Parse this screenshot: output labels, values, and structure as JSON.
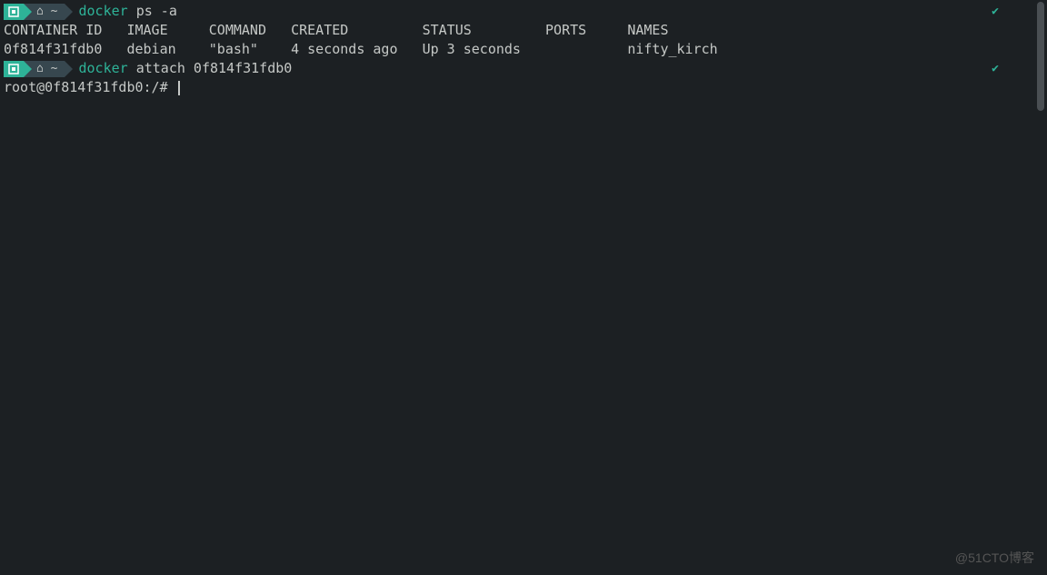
{
  "prompt1": {
    "badge_symbol": "⎕",
    "home_icon": "⌂",
    "tilde": "~",
    "command_docker": "docker",
    "command_args": " ps -a",
    "check": "✔"
  },
  "table": {
    "header": "CONTAINER ID   IMAGE     COMMAND   CREATED         STATUS         PORTS     NAMES",
    "row": "0f814f31fdb0   debian    \"bash\"    4 seconds ago   Up 3 seconds             nifty_kirch"
  },
  "prompt2": {
    "badge_symbol": "⎕",
    "home_icon": "⌂",
    "tilde": "~",
    "command_docker": "docker",
    "command_args": " attach 0f814f31fdb0",
    "check": "✔"
  },
  "shell_line": "root@0f814f31fdb0:/# ",
  "watermark": "@51CTO博客"
}
